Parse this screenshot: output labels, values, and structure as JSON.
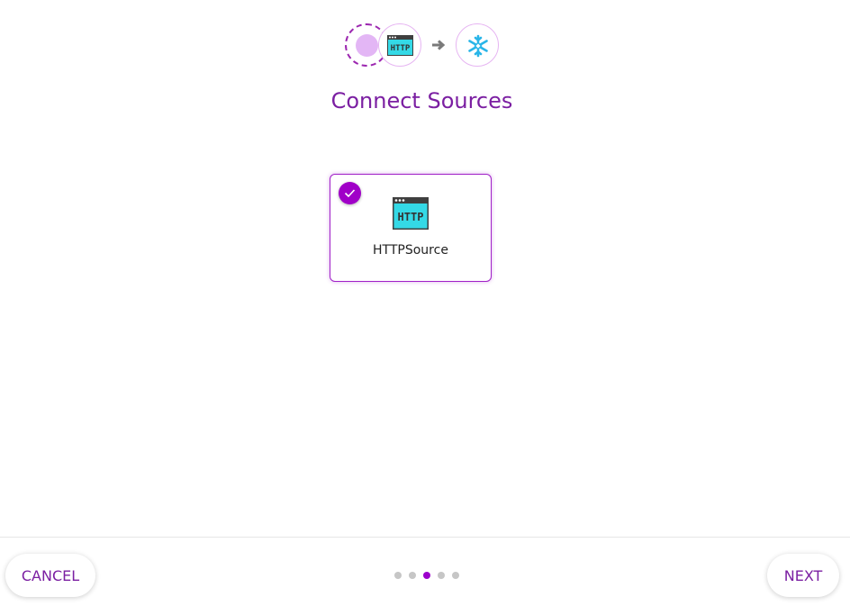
{
  "header": {
    "steps": [
      {
        "icon": "source-placeholder-icon",
        "state": "pending"
      },
      {
        "icon": "http-icon",
        "text": "HTTP"
      },
      {
        "icon": "arrow-right-icon"
      },
      {
        "icon": "snowflake-icon"
      }
    ],
    "title": "Connect Sources"
  },
  "sources": [
    {
      "label": "HTTPSource",
      "icon": "http-icon",
      "icon_text": "HTTP",
      "selected": true
    }
  ],
  "footer": {
    "cancel_label": "CANCEL",
    "next_label": "NEXT",
    "pager": {
      "total": 5,
      "current": 3
    }
  },
  "colors": {
    "accent": "#9c00cc",
    "title": "#7b1fa2",
    "http_screen": "#34d9e6",
    "snowflake": "#29b5e8"
  }
}
